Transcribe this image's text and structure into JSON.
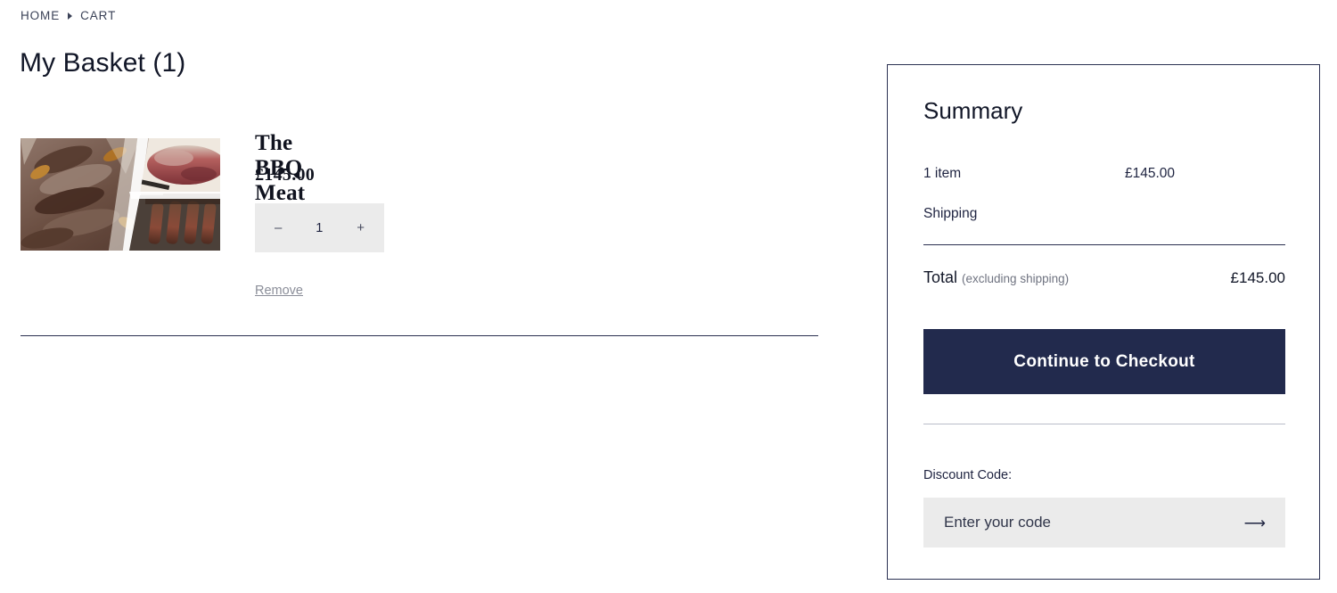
{
  "breadcrumb": {
    "home": "HOME",
    "separator_icon": "triangle-right-icon",
    "current": "CART"
  },
  "page": {
    "title": "My Basket (1)"
  },
  "cart": {
    "items": [
      {
        "image_alt": "bbq-meat-box-photo",
        "title": "The BBQ Meat Box",
        "price": "£145.00",
        "quantity": "1",
        "decrease_label": "–",
        "increase_label": "+",
        "remove_label": "Remove"
      }
    ]
  },
  "summary": {
    "title": "Summary",
    "item_count_label": "1 item",
    "item_count_value": "£145.00",
    "shipping_label": "Shipping",
    "total_label": "Total",
    "total_note": "(excluding shipping)",
    "total_value": "£145.00",
    "checkout_label": "Continue to Checkout",
    "discount_label": "Discount Code:",
    "discount_placeholder": "Enter your code",
    "discount_value": "",
    "discount_submit_icon": "arrow-right-icon"
  },
  "colors": {
    "accent_navy": "#222a4d",
    "field_gray": "#ebebeb",
    "text_dark": "#121728",
    "muted": "#8b8e99"
  }
}
